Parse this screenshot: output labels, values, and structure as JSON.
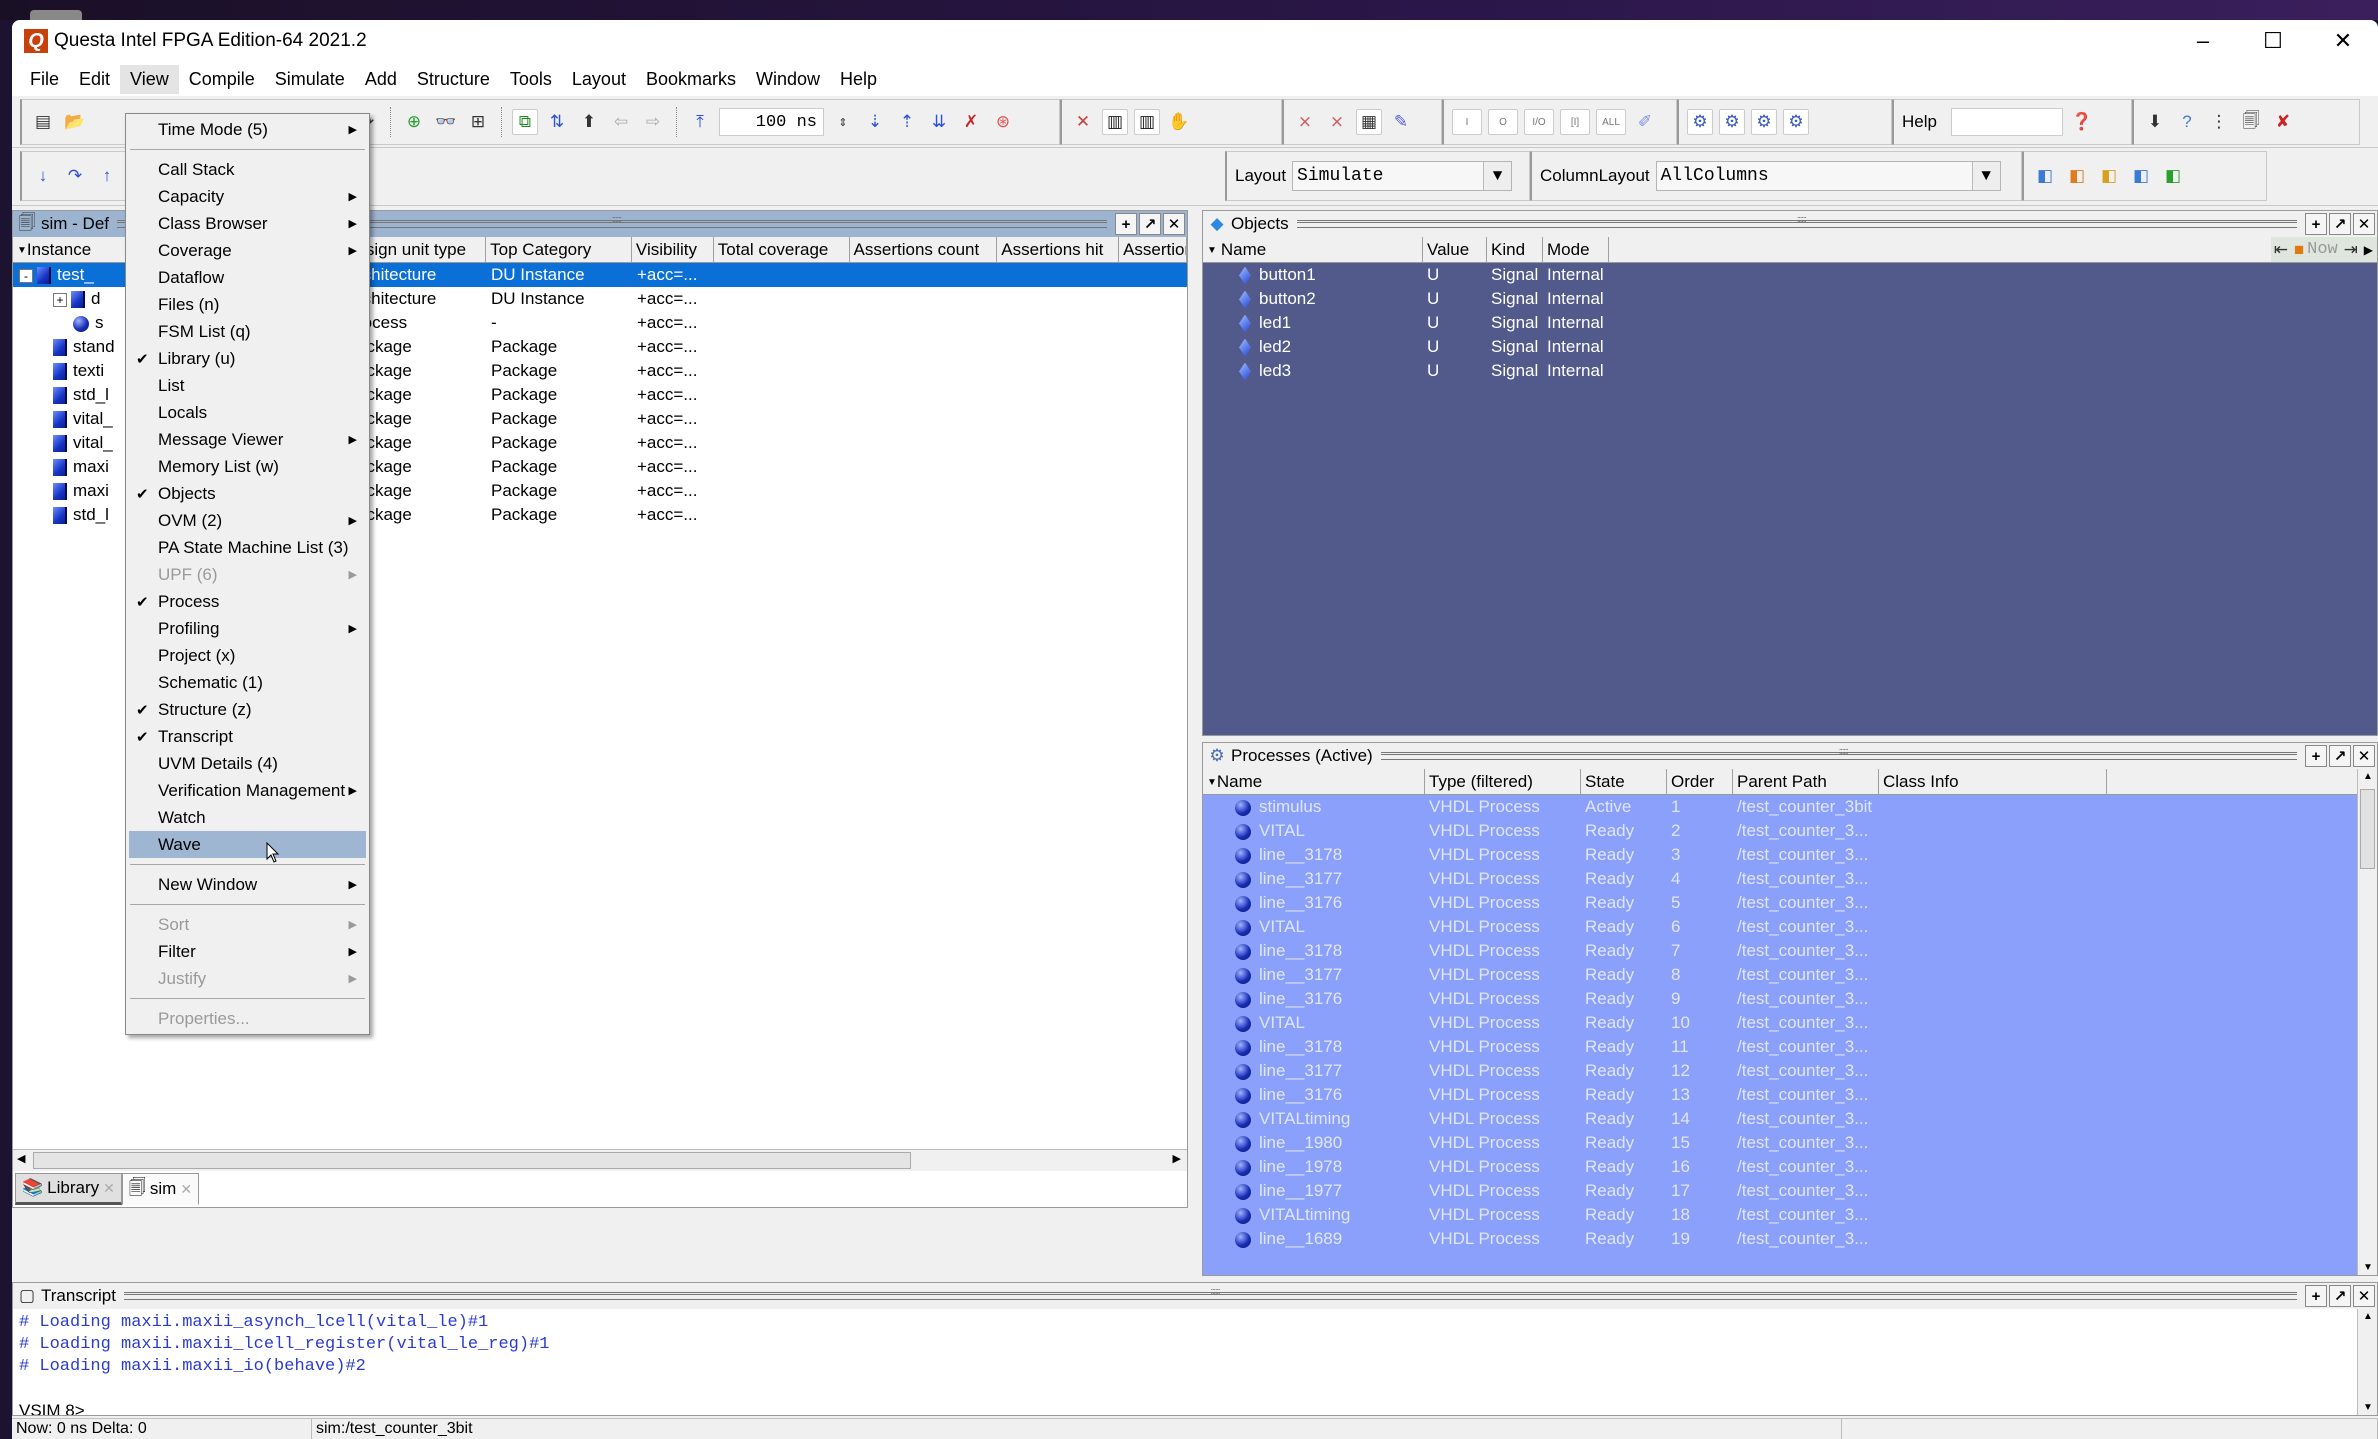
{
  "window": {
    "title": "Questa Intel FPGA Edition-64 2021.2",
    "app_icon": "Q",
    "controls": {
      "minimize": "–",
      "maximize": "☐",
      "close": "✕"
    }
  },
  "menubar": [
    "File",
    "Edit",
    "View",
    "Compile",
    "Simulate",
    "Add",
    "Structure",
    "Tools",
    "Layout",
    "Bookmarks",
    "Window",
    "Help"
  ],
  "toolbar": {
    "run_length": "100 ns",
    "help_label": "Help",
    "help_input": "",
    "layout_label": "Layout",
    "layout_value": "Simulate",
    "column_layout_label": "ColumnLayout",
    "column_layout_value": "AllColumns",
    "wave_buttons": [
      "I",
      "O",
      "I/O",
      "[I]",
      "ALL"
    ]
  },
  "view_menu": {
    "items": [
      {
        "label": "Time Mode (5)",
        "submenu": true
      },
      {
        "separator": true
      },
      {
        "label": "Call Stack"
      },
      {
        "label": "Capacity",
        "submenu": true
      },
      {
        "label": "Class Browser",
        "submenu": true
      },
      {
        "label": "Coverage",
        "submenu": true
      },
      {
        "label": "Dataflow"
      },
      {
        "label": "Files (n)"
      },
      {
        "label": "FSM List (q)"
      },
      {
        "label": "Library (u)",
        "checked": true
      },
      {
        "label": "List"
      },
      {
        "label": "Locals"
      },
      {
        "label": "Message Viewer",
        "submenu": true
      },
      {
        "label": "Memory List (w)"
      },
      {
        "label": "Objects",
        "checked": true
      },
      {
        "label": "OVM (2)",
        "submenu": true
      },
      {
        "label": "PA State Machine List (3)"
      },
      {
        "label": "UPF (6)",
        "submenu": true,
        "disabled": true
      },
      {
        "label": "Process",
        "checked": true
      },
      {
        "label": "Profiling",
        "submenu": true
      },
      {
        "label": "Project (x)"
      },
      {
        "label": "Schematic (1)"
      },
      {
        "label": "Structure  (z)",
        "checked": true
      },
      {
        "label": "Transcript",
        "checked": true
      },
      {
        "label": "UVM Details (4)"
      },
      {
        "label": "Verification Management",
        "submenu": true
      },
      {
        "label": "Watch"
      },
      {
        "label": "Wave",
        "hover": true
      },
      {
        "separator": true
      },
      {
        "label": "New Window",
        "submenu": true
      },
      {
        "separator": true
      },
      {
        "label": "Sort",
        "submenu": true,
        "disabled": true
      },
      {
        "label": "Filter",
        "submenu": true
      },
      {
        "label": "Justify",
        "submenu": true,
        "disabled": true
      },
      {
        "separator": true
      },
      {
        "label": "Properties...",
        "disabled": true
      }
    ]
  },
  "sim_pane": {
    "title": "sim - Default",
    "title_visible": "sim - Def",
    "columns": [
      "Instance",
      "Design unit type",
      "Top Category",
      "Visibility",
      "Total coverage",
      "Assertions count",
      "Assertions hit",
      "Assertion"
    ],
    "columns_visible": [
      "Instance",
      "esign unit type",
      "Top Category",
      "Visibility",
      "Total coverage",
      "Assertions count",
      "Assertions hit",
      "Assertion"
    ],
    "rows": [
      {
        "instance": "test_",
        "type": "rchitecture",
        "category": "DU Instance",
        "visibility": "+acc=...",
        "icon": "block",
        "expander": "-",
        "selected": true,
        "indent": 0
      },
      {
        "instance": "d",
        "type": "rchitecture",
        "category": "DU Instance",
        "visibility": "+acc=...",
        "icon": "block",
        "expander": "+",
        "indent": 1
      },
      {
        "instance": "s",
        "type": "rocess",
        "category": "-",
        "visibility": "+acc=...",
        "icon": "process",
        "indent": 1
      },
      {
        "instance": "stand",
        "type": "ackage",
        "category": "Package",
        "visibility": "+acc=...",
        "icon": "block",
        "indent": 0
      },
      {
        "instance": "texti",
        "type": "ackage",
        "category": "Package",
        "visibility": "+acc=...",
        "icon": "block",
        "indent": 0
      },
      {
        "instance": "std_l",
        "type": "ackage",
        "category": "Package",
        "visibility": "+acc=...",
        "icon": "block",
        "indent": 0
      },
      {
        "instance": "vital_",
        "type": "ackage",
        "category": "Package",
        "visibility": "+acc=...",
        "icon": "block",
        "indent": 0
      },
      {
        "instance": "vital_",
        "type": "ackage",
        "category": "Package",
        "visibility": "+acc=...",
        "icon": "block",
        "indent": 0
      },
      {
        "instance": "maxi",
        "type": "ackage",
        "category": "Package",
        "visibility": "+acc=...",
        "icon": "block",
        "indent": 0
      },
      {
        "instance": "maxi",
        "type": "ackage",
        "category": "Package",
        "visibility": "+acc=...",
        "icon": "block",
        "indent": 0
      },
      {
        "instance": "std_l",
        "type": "ackage",
        "category": "Package",
        "visibility": "+acc=...",
        "icon": "block",
        "indent": 0
      }
    ],
    "tabs": [
      {
        "label": "Library",
        "active": false
      },
      {
        "label": "sim",
        "active": true
      }
    ]
  },
  "objects_pane": {
    "title": "Objects",
    "columns": [
      "Name",
      "Value",
      "Kind",
      "Mode"
    ],
    "now_label": "Now",
    "rows": [
      {
        "name": "button1",
        "value": "U",
        "kind": "Signal",
        "mode": "Internal"
      },
      {
        "name": "button2",
        "value": "U",
        "kind": "Signal",
        "mode": "Internal"
      },
      {
        "name": "led1",
        "value": "U",
        "kind": "Signal",
        "mode": "Internal"
      },
      {
        "name": "led2",
        "value": "U",
        "kind": "Signal",
        "mode": "Internal"
      },
      {
        "name": "led3",
        "value": "U",
        "kind": "Signal",
        "mode": "Internal"
      }
    ]
  },
  "processes_pane": {
    "title": "Processes (Active)",
    "columns": [
      "Name",
      "Type (filtered)",
      "State",
      "Order",
      "Parent Path",
      "Class Info"
    ],
    "rows": [
      {
        "name": "stimulus",
        "type": "VHDL Process",
        "state": "Active",
        "order": "1",
        "parent": "/test_counter_3bit"
      },
      {
        "name": "VITAL",
        "type": "VHDL Process",
        "state": "Ready",
        "order": "2",
        "parent": "/test_counter_3..."
      },
      {
        "name": "line__3178",
        "type": "VHDL Process",
        "state": "Ready",
        "order": "3",
        "parent": "/test_counter_3..."
      },
      {
        "name": "line__3177",
        "type": "VHDL Process",
        "state": "Ready",
        "order": "4",
        "parent": "/test_counter_3..."
      },
      {
        "name": "line__3176",
        "type": "VHDL Process",
        "state": "Ready",
        "order": "5",
        "parent": "/test_counter_3..."
      },
      {
        "name": "VITAL",
        "type": "VHDL Process",
        "state": "Ready",
        "order": "6",
        "parent": "/test_counter_3..."
      },
      {
        "name": "line__3178",
        "type": "VHDL Process",
        "state": "Ready",
        "order": "7",
        "parent": "/test_counter_3..."
      },
      {
        "name": "line__3177",
        "type": "VHDL Process",
        "state": "Ready",
        "order": "8",
        "parent": "/test_counter_3..."
      },
      {
        "name": "line__3176",
        "type": "VHDL Process",
        "state": "Ready",
        "order": "9",
        "parent": "/test_counter_3..."
      },
      {
        "name": "VITAL",
        "type": "VHDL Process",
        "state": "Ready",
        "order": "10",
        "parent": "/test_counter_3..."
      },
      {
        "name": "line__3178",
        "type": "VHDL Process",
        "state": "Ready",
        "order": "11",
        "parent": "/test_counter_3..."
      },
      {
        "name": "line__3177",
        "type": "VHDL Process",
        "state": "Ready",
        "order": "12",
        "parent": "/test_counter_3..."
      },
      {
        "name": "line__3176",
        "type": "VHDL Process",
        "state": "Ready",
        "order": "13",
        "parent": "/test_counter_3..."
      },
      {
        "name": "VITALtiming",
        "type": "VHDL Process",
        "state": "Ready",
        "order": "14",
        "parent": "/test_counter_3..."
      },
      {
        "name": "line__1980",
        "type": "VHDL Process",
        "state": "Ready",
        "order": "15",
        "parent": "/test_counter_3..."
      },
      {
        "name": "line__1978",
        "type": "VHDL Process",
        "state": "Ready",
        "order": "16",
        "parent": "/test_counter_3..."
      },
      {
        "name": "line__1977",
        "type": "VHDL Process",
        "state": "Ready",
        "order": "17",
        "parent": "/test_counter_3..."
      },
      {
        "name": "VITALtiming",
        "type": "VHDL Process",
        "state": "Ready",
        "order": "18",
        "parent": "/test_counter_3..."
      },
      {
        "name": "line__1689",
        "type": "VHDL Process",
        "state": "Ready",
        "order": "19",
        "parent": "/test_counter_3..."
      }
    ]
  },
  "transcript": {
    "title": "Transcript",
    "lines": [
      "# Loading maxii.maxii_asynch_lcell(vital_le)#1",
      "# Loading maxii.maxii_lcell_register(vital_le_reg)#1",
      "# Loading maxii.maxii_io(behave)#2"
    ],
    "prompt": "VSIM 8>"
  },
  "statusbar": {
    "now": "Now: 0 ns  Delta: 0",
    "context": "sim:/test_counter_3bit"
  },
  "colors": {
    "selection": "#0a6fd6",
    "objects_bg": "#515a8a",
    "processes_bg": "#8ba0fa",
    "menu_hover": "#9eb6d2",
    "transcript_text": "#2a3cd0"
  }
}
